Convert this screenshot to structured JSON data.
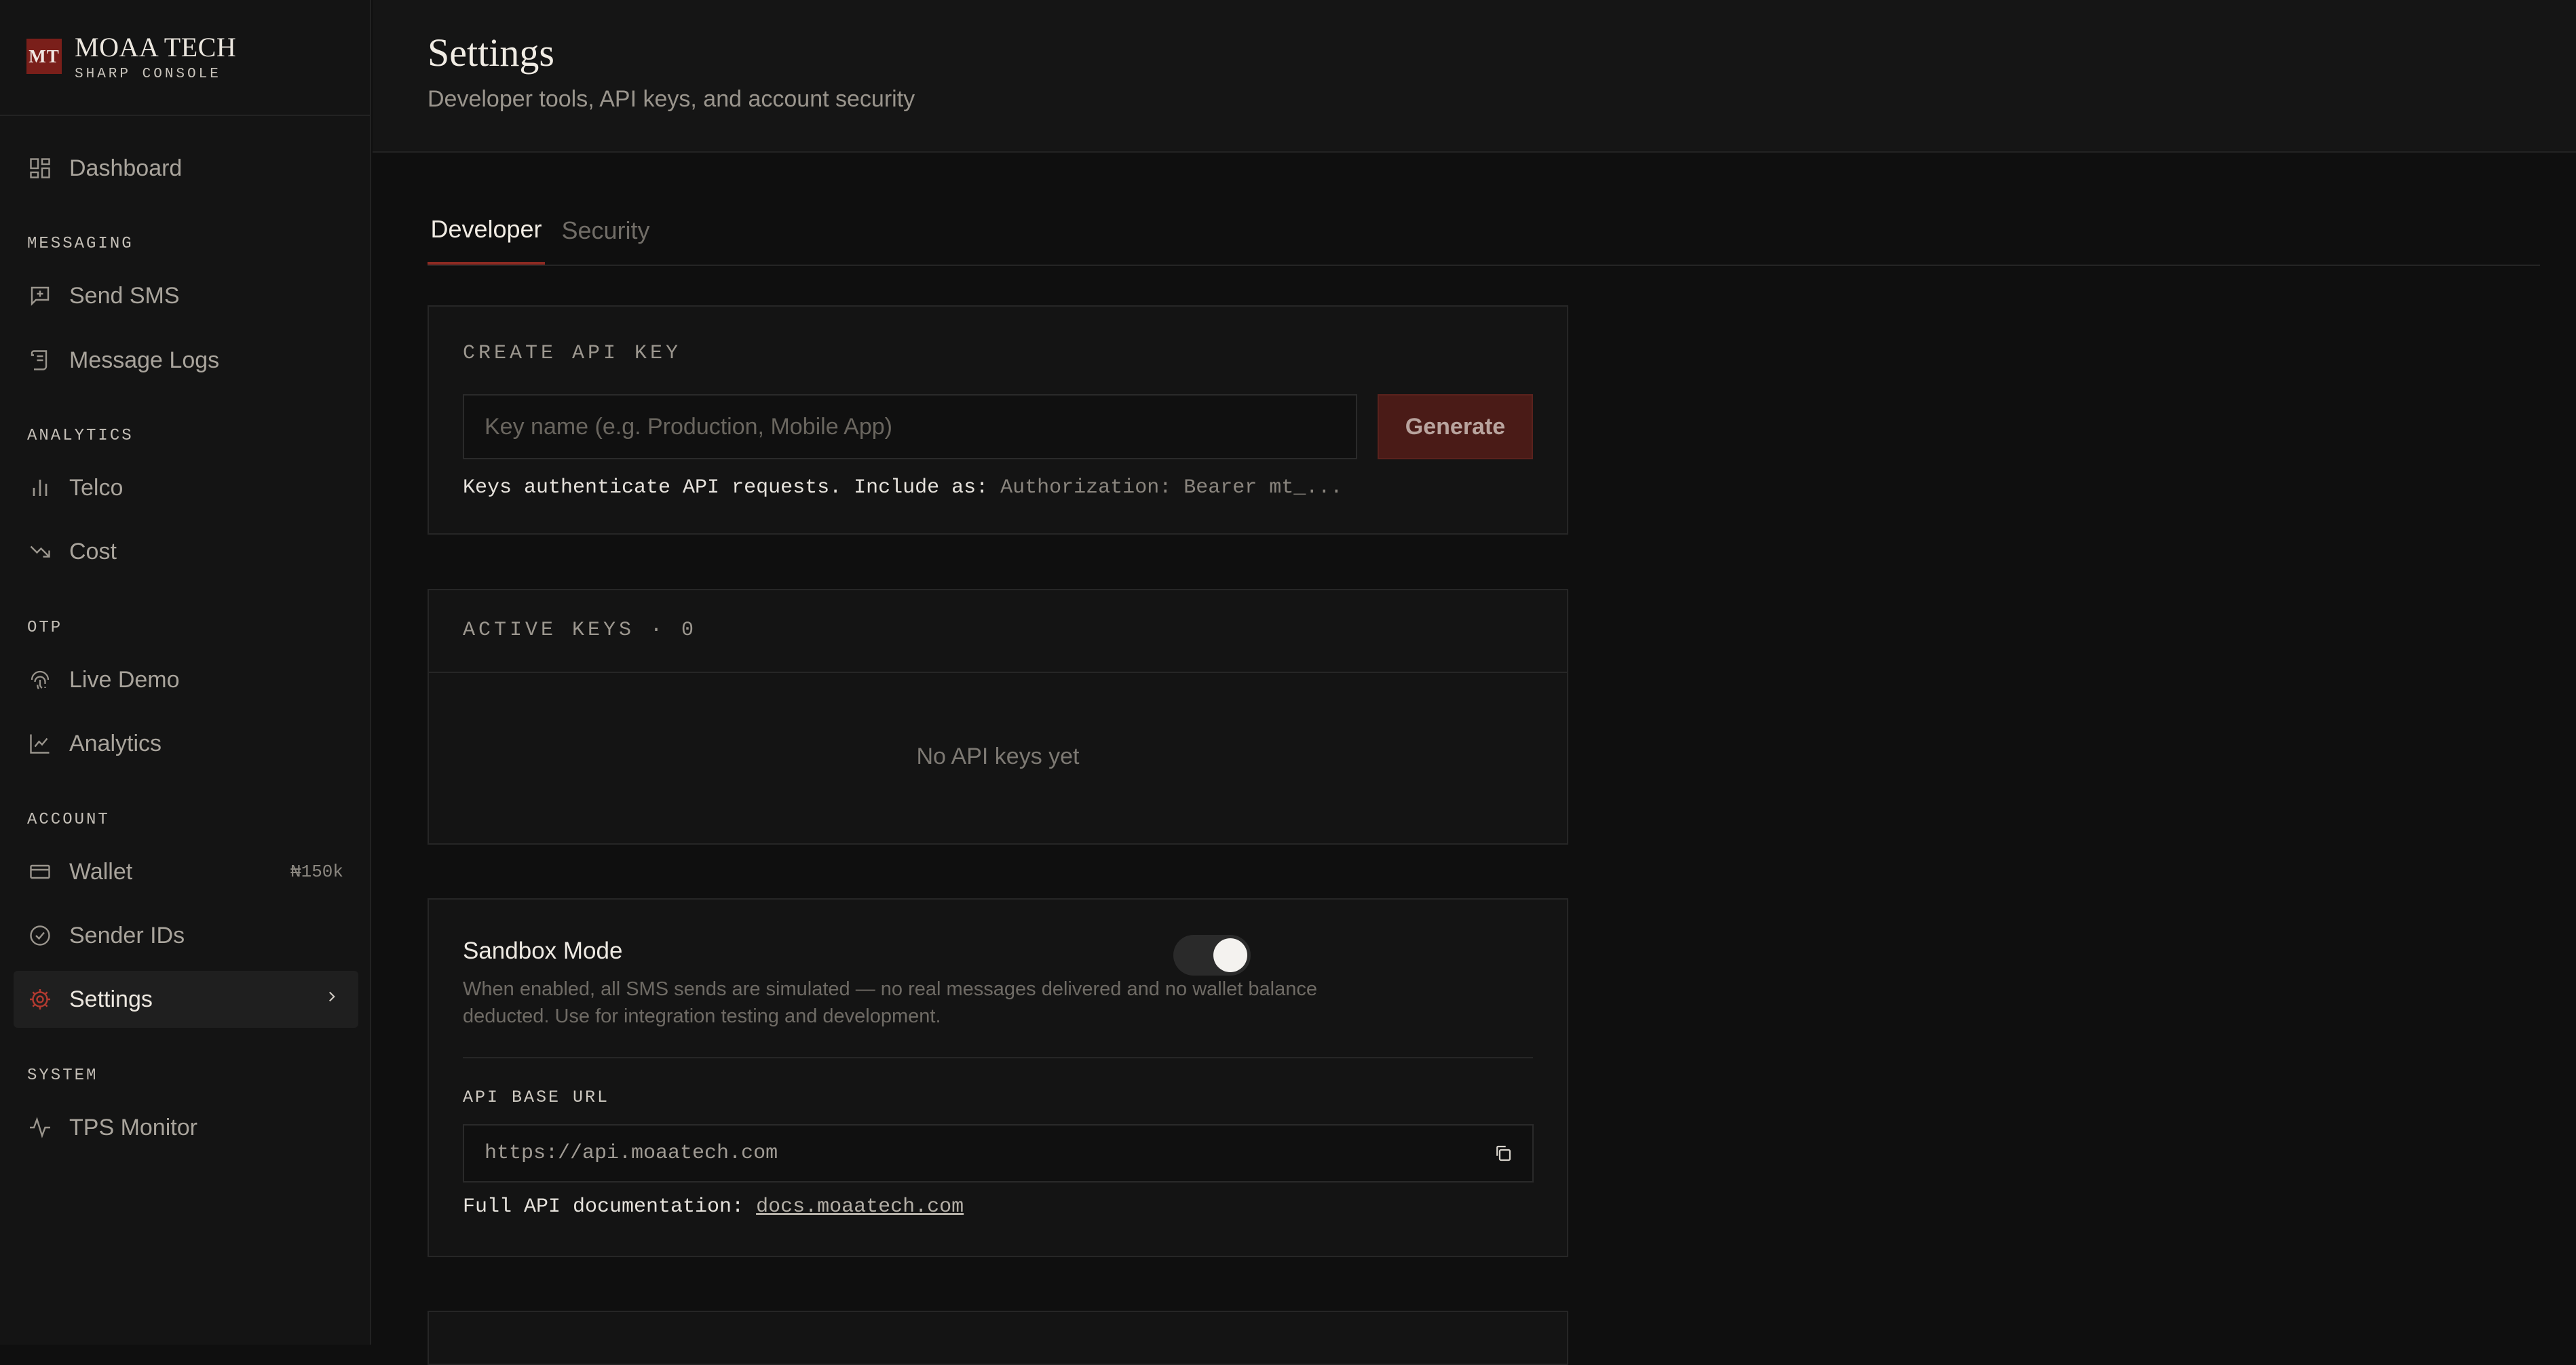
{
  "brand": {
    "logo": "MT",
    "name": "MOAA TECH",
    "subtitle": "SHARP CONSOLE"
  },
  "sidebar": {
    "sections": [
      {
        "label": "MESSAGING"
      },
      {
        "label": "ANALYTICS"
      },
      {
        "label": "OTP"
      },
      {
        "label": "ACCOUNT"
      },
      {
        "label": "SYSTEM"
      }
    ],
    "items": [
      {
        "label": "Dashboard",
        "icon": "dashboard-icon"
      },
      {
        "label": "Send SMS",
        "icon": "message-plus-icon"
      },
      {
        "label": "Message Logs",
        "icon": "scroll-icon"
      },
      {
        "label": "Telco",
        "icon": "bar-chart-icon"
      },
      {
        "label": "Cost",
        "icon": "trend-down-icon"
      },
      {
        "label": "Live Demo",
        "icon": "fingerprint-icon"
      },
      {
        "label": "Analytics",
        "icon": "line-chart-icon"
      },
      {
        "label": "Wallet",
        "icon": "wallet-card-icon",
        "badge": "₦150k"
      },
      {
        "label": "Sender IDs",
        "icon": "badge-check-icon"
      },
      {
        "label": "Settings",
        "icon": "gear-icon",
        "active": true,
        "accent": "#b33a30"
      },
      {
        "label": "TPS Monitor",
        "icon": "activity-icon"
      }
    ]
  },
  "header": {
    "title": "Settings",
    "subtitle": "Developer tools, API keys, and account security"
  },
  "tabs": [
    {
      "label": "Developer",
      "active": true
    },
    {
      "label": "Security",
      "active": false
    }
  ],
  "create_key": {
    "title": "CREATE API KEY",
    "placeholder": "Key name (e.g. Production, Mobile App)",
    "value": "",
    "button": "Generate",
    "helper_prefix": "Keys authenticate API requests. Include as:",
    "helper_code": "Authorization: Bearer mt_..."
  },
  "active_keys": {
    "title": "ACTIVE KEYS · 0",
    "empty_text": "No API keys yet"
  },
  "sandbox": {
    "title": "Sandbox Mode",
    "description_line1": "When enabled, all SMS sends are simulated — no real messages delivered and no wallet balance",
    "description_line2": "deducted. Use for integration testing and development.",
    "enabled": true,
    "api_base_label": "API BASE URL",
    "api_base_url": "https://api.moaatech.com",
    "docs_prefix": "Full API documentation:",
    "docs_link": "docs.moaatech.com"
  },
  "colors": {
    "accent": "#8d2a22",
    "background": "#0f0f0f",
    "card": "#141414"
  }
}
